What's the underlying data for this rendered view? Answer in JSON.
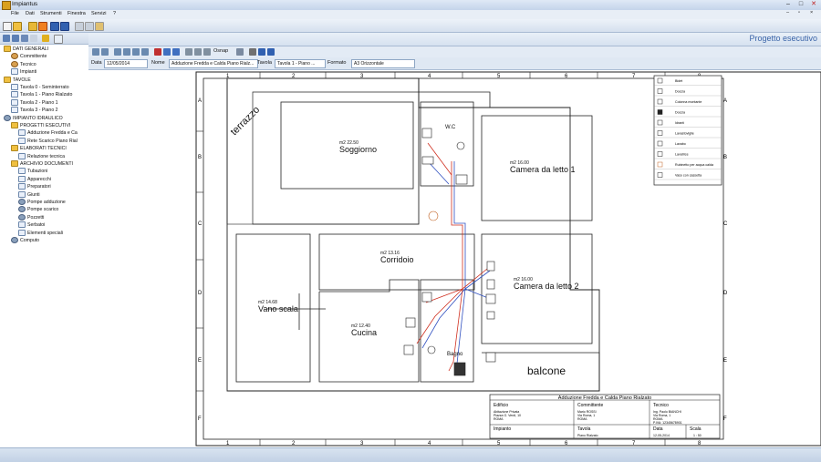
{
  "app": {
    "title": "Impiantus"
  },
  "menu": [
    "File",
    "Dati",
    "Strumenti",
    "Finestra",
    "Servizi",
    "?"
  ],
  "header": {
    "title": "Progetto esecutivo"
  },
  "tree": [
    {
      "label": "DATI GENERALI",
      "level": 0,
      "icon": "folder-icon"
    },
    {
      "label": "Committente",
      "level": 1,
      "icon": "person-icon"
    },
    {
      "label": "Tecnico",
      "level": 1,
      "icon": "person-icon"
    },
    {
      "label": "Impianti",
      "level": 1,
      "icon": "doc-icon"
    },
    {
      "label": "TAVOLE",
      "level": 0,
      "icon": "folder-icon"
    },
    {
      "label": "Tavola 0 - Seminterrato",
      "level": 1,
      "icon": "doc-icon"
    },
    {
      "label": "Tavola 1 - Piano Rialzato",
      "level": 1,
      "icon": "doc-icon"
    },
    {
      "label": "Tavola 2 - Piano 1",
      "level": 1,
      "icon": "doc-icon"
    },
    {
      "label": "Tavola 3 - Piano 2",
      "level": 1,
      "icon": "doc-icon"
    },
    {
      "label": "IMPIANTO IDRAULICO",
      "level": 0,
      "icon": "gear-icon"
    },
    {
      "label": "PROGETTI ESECUTIVI",
      "level": 1,
      "icon": "folder-icon"
    },
    {
      "label": "Adduzione Fredda e Ca",
      "level": 2,
      "icon": "doc-icon"
    },
    {
      "label": "Rete Scarico Piano Rial",
      "level": 2,
      "icon": "doc-icon"
    },
    {
      "label": "ELABORATI TECNICI",
      "level": 1,
      "icon": "folder-icon"
    },
    {
      "label": "Relazione tecnica",
      "level": 2,
      "icon": "doc-icon"
    },
    {
      "label": "ARCHIVIO DOCUMENTI",
      "level": 1,
      "icon": "folder-icon"
    },
    {
      "label": "Tubazioni",
      "level": 2,
      "icon": "doc-icon"
    },
    {
      "label": "Apparecchi",
      "level": 2,
      "icon": "doc-icon"
    },
    {
      "label": "Preparatori",
      "level": 2,
      "icon": "doc-icon"
    },
    {
      "label": "Giunti",
      "level": 2,
      "icon": "doc-icon"
    },
    {
      "label": "Pompe adduzione",
      "level": 2,
      "icon": "gear-icon"
    },
    {
      "label": "Pompe scarico",
      "level": 2,
      "icon": "gear-icon"
    },
    {
      "label": "Pozzetti",
      "level": 2,
      "icon": "gear-icon"
    },
    {
      "label": "Serbatoi",
      "level": 2,
      "icon": "doc-icon"
    },
    {
      "label": "Elementi speciali",
      "level": 2,
      "icon": "doc-icon"
    },
    {
      "label": "Computo",
      "level": 1,
      "icon": "gear-icon"
    }
  ],
  "drawtools": {
    "osnap": "Osnap"
  },
  "fields": {
    "data_label": "Data",
    "data_value": "12/05/2014",
    "nome_label": "Nome",
    "nome_value": "Adduzione Fredda e Calda Piano Rialz...",
    "tavola_label": "Tavola",
    "tavola_value": "Tavola 1 - Piano ...",
    "formato_label": "Formato",
    "formato_value": "A3 Orizzontale"
  },
  "drawing": {
    "columns": [
      "1",
      "2",
      "3",
      "4",
      "5",
      "6",
      "7",
      "8"
    ],
    "rows": [
      "A",
      "B",
      "C",
      "D",
      "E",
      "F"
    ],
    "rooms": [
      {
        "name": "terrazzo"
      },
      {
        "name": "Soggiorno",
        "area": "m2 22.50"
      },
      {
        "name": "W.C"
      },
      {
        "name": "Camera da letto 1",
        "area": "m2 16.00"
      },
      {
        "name": "Corridoio",
        "area": "m2 13.16"
      },
      {
        "name": "Vano scala",
        "area": "m2 14.68"
      },
      {
        "name": "Cucina",
        "area": "m2 12.40"
      },
      {
        "name": "Bagno"
      },
      {
        "name": "Camera da letto 2",
        "area": "m2 16.00"
      },
      {
        "name": "balcone"
      }
    ],
    "legend": [
      "Bidet",
      "Doccia",
      "Colonna montante",
      "Doccia",
      "Idranti",
      "Lavastoviglie",
      "Lavabo",
      "Lavatrice",
      "Rubinetto per acqua calda",
      "Vaso con cassetta"
    ],
    "titleblock": {
      "title": "Adduzione Fredda e Calda Piano Rialzato",
      "edificio_label": "Edificio",
      "edificio_value": "Abitazione Privata",
      "edificio_addr1": "Piazza G. Verdi, 10",
      "edificio_addr2": "ROMA",
      "committente_label": "Committente",
      "committente_value": "Mario ROSSI",
      "committente_addr1": "Via Roma, 1",
      "committente_addr2": "ROMA",
      "tecnico_label": "Tecnico",
      "tecnico_value": "Ing. Paolo BIANCHI",
      "tecnico_addr1": "Via Roma, 1",
      "tecnico_addr2": "ROMA",
      "tecnico_piva": "P.IVA: 12345678901",
      "impianto_label": "Impianto",
      "tavola_label": "Tavola",
      "tavola_value": "Piano Rialzato",
      "data_label": "Data",
      "data_value": "12-05-2014",
      "scala_label": "Scala",
      "scala_value": "1 : 50"
    }
  },
  "colors": {
    "accent": "#3a64a8",
    "pipe_cold": "#3050c0",
    "pipe_hot": "#d03020"
  }
}
